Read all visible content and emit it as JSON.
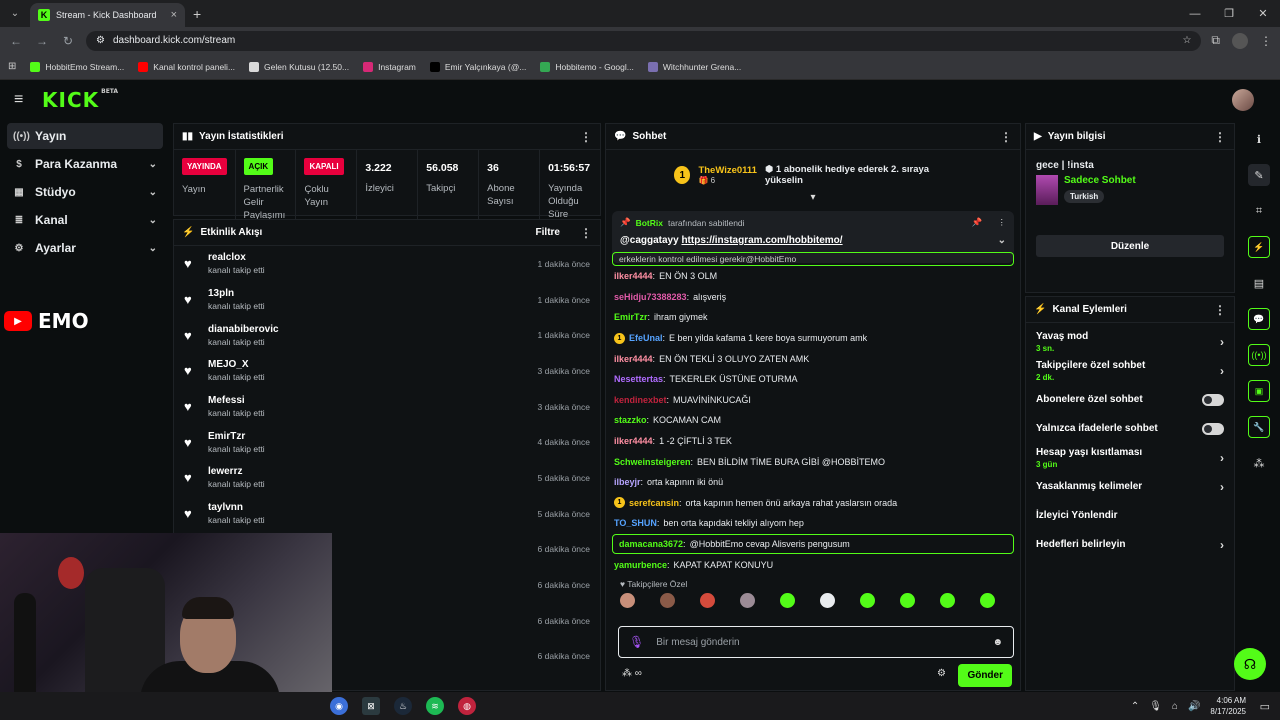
{
  "browser": {
    "tab_title": "Stream - Kick Dashboard",
    "url": "dashboard.kick.com/stream",
    "bookmarks": [
      {
        "label": "HobbitEmo Stream...",
        "color": "#53fc18"
      },
      {
        "label": "Kanal kontrol paneli...",
        "color": "#ff0000"
      },
      {
        "label": "Gelen Kutusu (12.50...",
        "color": "#d9d9d9"
      },
      {
        "label": "Instagram",
        "color": "#d62976"
      },
      {
        "label": "Emir Yalçınkaya (@...",
        "color": "#000000"
      },
      {
        "label": "Hobbitemo - Googl...",
        "color": "#34a853"
      },
      {
        "label": "Witchhunter Grena...",
        "color": "#7a6fb0"
      }
    ]
  },
  "header": {
    "logo": "KICK",
    "logo_beta": "BETA"
  },
  "leftnav": {
    "items": [
      {
        "label": "Yayın",
        "icon": "broadcast-icon"
      },
      {
        "label": "Para Kazanma",
        "icon": "dollar-icon"
      },
      {
        "label": "Stüdyo",
        "icon": "studio-icon"
      },
      {
        "label": "Kanal",
        "icon": "channel-icon"
      },
      {
        "label": "Ayarlar",
        "icon": "gear-icon"
      }
    ],
    "overlay_text": "EMO"
  },
  "stats_panel": {
    "title": "Yayın İstatistikleri",
    "cells": [
      {
        "badge": "YAYINDA",
        "badge_type": "red",
        "label": "Yayın"
      },
      {
        "badge": "AÇIK",
        "badge_type": "green",
        "label": "Partnerlik Gelir Paylaşımı"
      },
      {
        "badge": "KAPALI",
        "badge_type": "red",
        "label": "Çoklu Yayın"
      },
      {
        "value": "3.222",
        "label": "İzleyici"
      },
      {
        "value": "56.058",
        "label": "Takipçi"
      },
      {
        "value": "36",
        "label": "Abone Sayısı"
      },
      {
        "value": "01:56:57",
        "label": "Yayında Olduğu Süre"
      }
    ]
  },
  "activity_panel": {
    "title": "Etkinlik Akışı",
    "filter_label": "Filtre",
    "rows": [
      {
        "user": "realclox",
        "action": "kanalı takip etti",
        "time": "1 dakika önce"
      },
      {
        "user": "13pln",
        "action": "kanalı takip etti",
        "time": "1 dakika önce"
      },
      {
        "user": "dianabiberovic",
        "action": "kanalı takip etti",
        "time": "1 dakika önce"
      },
      {
        "user": "MEJO_X",
        "action": "kanalı takip etti",
        "time": "3 dakika önce"
      },
      {
        "user": "Mefessi",
        "action": "kanalı takip etti",
        "time": "3 dakika önce"
      },
      {
        "user": "EmirTzr",
        "action": "kanalı takip etti",
        "time": "4 dakika önce"
      },
      {
        "user": "lewerrz",
        "action": "kanalı takip etti",
        "time": "5 dakika önce"
      },
      {
        "user": "taylvnn",
        "action": "kanalı takip etti",
        "time": "5 dakika önce"
      },
      {
        "user": "",
        "action": "",
        "time": "6 dakika önce"
      },
      {
        "user": "",
        "action": "",
        "time": "6 dakika önce"
      },
      {
        "user": "",
        "action": "",
        "time": "6 dakika önce"
      },
      {
        "user": "",
        "action": "",
        "time": "6 dakika önce"
      }
    ]
  },
  "chat_panel": {
    "title": "Sohbet",
    "gift_user": "TheWize0111",
    "gift_count": "6",
    "gift_text": "1 abonelik hediye ederek 2. sıraya yükselin",
    "pinned_by": "BotRix",
    "pinned_suffix": "tarafından sabitlendi",
    "pinned_mention": "@caggatayy",
    "pinned_link": "https://instagram.com/hobbitemo/",
    "partial_line": "erkeklerin kontrol edilmesi gerekir@HobbitEmo",
    "messages": [
      {
        "name": "ilker4444",
        "color": "#ff8fa3",
        "text": "EN ÖN 3 OLM"
      },
      {
        "name": "seHidju73388283",
        "color": "#e05aa8",
        "text": "alışveriş"
      },
      {
        "name": "EmirTzr",
        "color": "#53fc18",
        "text": "ihram giymek"
      },
      {
        "name": "EfeUnal",
        "color": "#56a3ff",
        "text": "E ben yilda kafama 1 kere boya surmuyorum amk",
        "coin": "1"
      },
      {
        "name": "ilker4444",
        "color": "#ff8fa3",
        "text": "EN ÖN TEKLİ 3 OLUYO ZATEN AMK"
      },
      {
        "name": "Nesettertas",
        "color": "#b06cff",
        "text": "TEKERLEK ÜSTÜNE OTURMA"
      },
      {
        "name": "kendinexbet",
        "color": "#c0233d",
        "text": "MUAVİNİNKUCAĞI"
      },
      {
        "name": "stazzko",
        "color": "#53fc18",
        "text": "KOCAMAN CAM"
      },
      {
        "name": "ilker4444",
        "color": "#ff8fa3",
        "text": "1 -2 ÇİFTLİ 3 TEK"
      },
      {
        "name": "Schweinsteigeren",
        "color": "#53fc18",
        "text": "BEN BİLDİM TİME BURA GİBİ @HOBBİTEMO"
      },
      {
        "name": "ilbeyjr",
        "color": "#b6a4ff",
        "text": "orta kapının iki önü"
      },
      {
        "name": "serefcansin",
        "color": "#f7c31a",
        "text": "orta kapının hemen önü arkaya rahat yaslarsın orada",
        "coin": "1"
      },
      {
        "name": "TO_SHUN",
        "color": "#56a3ff",
        "text": "ben orta kapıdaki tekliyi alıyom hep"
      },
      {
        "name": "damacana3672",
        "color": "#53fc18",
        "text": "@HobbitEmo cevap Alisveris pengusum",
        "highlight": true
      },
      {
        "name": "yamurbence",
        "color": "#53fc18",
        "text": "KAPAT KAPAT KONUYU"
      }
    ],
    "followers_only_label": "Takipçilere Özel",
    "emote_colors": [
      "#c88f7a",
      "#8a5a48",
      "#d44b3c",
      "#9b8b96",
      "#53fc18",
      "#e9ecef",
      "#53fc18",
      "#53fc18",
      "#53fc18",
      "#53fc18"
    ],
    "input_placeholder": "Bir mesaj gönderin",
    "send_label": "Gönder"
  },
  "stream_info": {
    "title": "Yayın bilgisi",
    "stream_title": "gece | !insta",
    "category": "Sadece Sohbet",
    "language": "Turkish",
    "edit_label": "Düzenle"
  },
  "channel_actions": {
    "title": "Kanal Eylemleri",
    "rows": [
      {
        "label": "Yavaş mod",
        "sub": "3 sn.",
        "type": "arrow"
      },
      {
        "label": "Takipçilere özel sohbet",
        "sub": "2 dk.",
        "type": "arrow"
      },
      {
        "label": "Abonelere özel sohbet",
        "sub": "",
        "type": "toggle"
      },
      {
        "label": "Yalnızca ifadelerle sohbet",
        "sub": "",
        "type": "toggle"
      },
      {
        "label": "Hesap yaşı kısıtlaması",
        "sub": "3 gün",
        "type": "arrow"
      },
      {
        "label": "Yasaklanmış kelimeler",
        "sub": "",
        "type": "arrow"
      },
      {
        "label": "İzleyici Yönlendir",
        "sub": "",
        "type": "none"
      },
      {
        "label": "Hedefleri belirleyin",
        "sub": "",
        "type": "arrow"
      }
    ]
  },
  "taskbar": {
    "time": "4:06 AM",
    "date": "8/17/2025"
  }
}
